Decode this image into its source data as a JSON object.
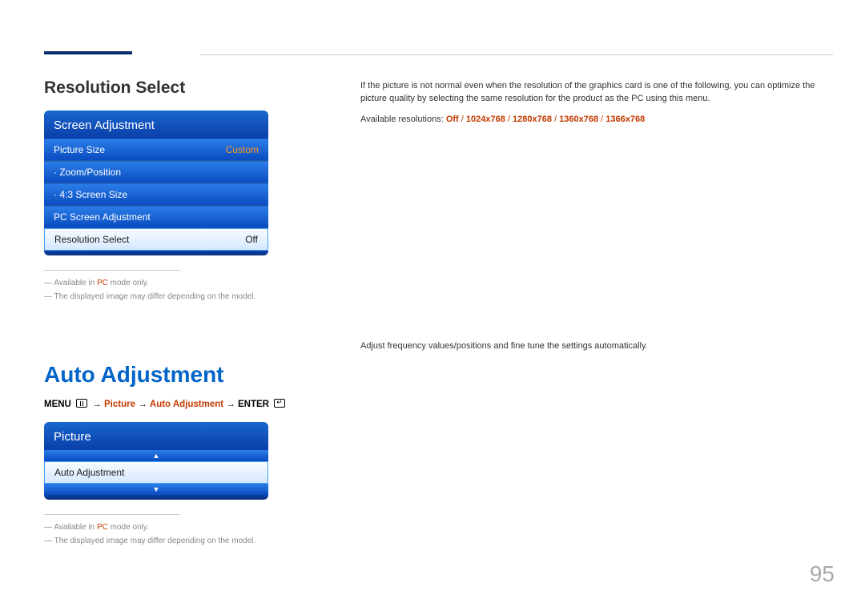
{
  "header": {},
  "section1": {
    "heading": "Resolution Select",
    "osd": {
      "title": "Screen Adjustment",
      "rows": [
        {
          "label": "Picture Size",
          "value": "Custom",
          "selected": false
        },
        {
          "label": "· Zoom/Position",
          "value": "",
          "selected": false
        },
        {
          "label": "· 4:3 Screen Size",
          "value": "",
          "selected": false
        },
        {
          "label": "PC Screen Adjustment",
          "value": "",
          "selected": false
        },
        {
          "label": "Resolution Select",
          "value": "Off",
          "selected": true
        }
      ]
    },
    "notes": {
      "line1_pre": "Available in ",
      "line1_em": "PC",
      "line1_post": " mode only.",
      "line2": "The displayed image may differ depending on the model."
    },
    "body": {
      "para": "If the picture is not normal even when the resolution of the graphics card is one of the following, you can optimize the picture quality by selecting the same resolution for the product as the PC using this menu.",
      "res_label": "Available resolutions: ",
      "res_values": [
        "Off",
        "1024x768",
        "1280x768",
        "1360x768",
        "1366x768"
      ],
      "sep": " / "
    }
  },
  "section2": {
    "heading": "Auto Adjustment",
    "path": {
      "p1": "MENU",
      "arrow": " → ",
      "p2": "Picture",
      "p3": "Auto Adjustment",
      "p4": "ENTER"
    },
    "osd": {
      "title": "Picture",
      "rows": [
        {
          "label": "Auto Adjustment",
          "value": "",
          "selected": true
        }
      ]
    },
    "notes": {
      "line1_pre": "Available in ",
      "line1_em": "PC",
      "line1_post": " mode only.",
      "line2": "The displayed image may differ depending on the model."
    },
    "body": {
      "para": "Adjust frequency values/positions and fine tune the settings automatically."
    }
  },
  "page_number": "95"
}
